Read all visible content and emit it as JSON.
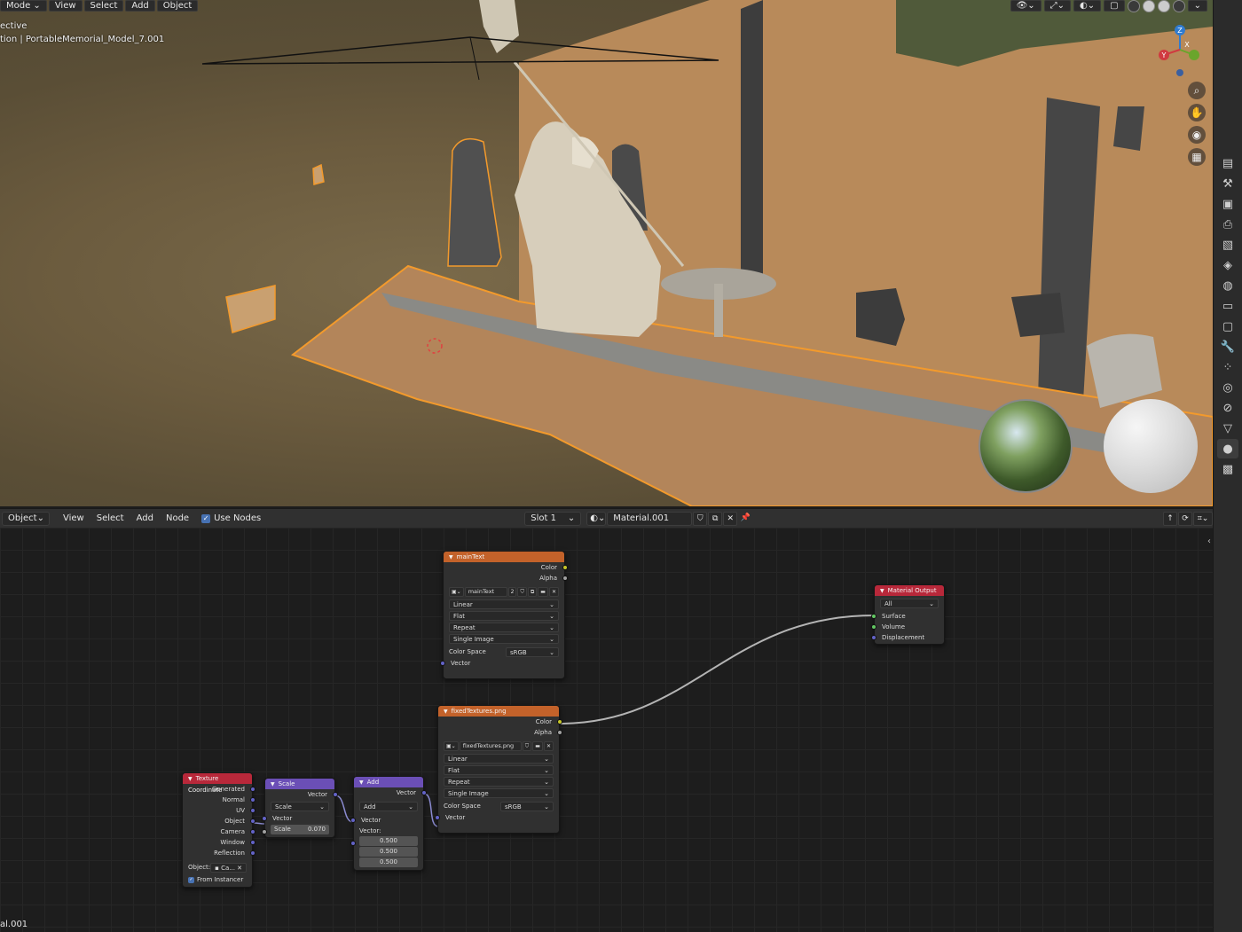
{
  "viewport": {
    "header": {
      "mode": "Mode",
      "menus": [
        "View",
        "Select",
        "Add",
        "Object"
      ]
    },
    "overlay_line1": "ective",
    "overlay_line2": "tion | PortableMemorial_Model_7.001",
    "gizmo_labels": {
      "z": "Z",
      "y": "Y",
      "x": "X"
    }
  },
  "node_editor": {
    "header": {
      "object_mode": "Object",
      "menus": [
        "View",
        "Select",
        "Add",
        "Node"
      ],
      "use_nodes_label": "Use Nodes",
      "slot": "Slot 1",
      "material": "Material.001"
    },
    "nodes": {
      "main_text": {
        "title": "mainText",
        "outputs": [
          "Color",
          "Alpha"
        ],
        "image_name": "mainText",
        "users": "2",
        "interpolation": "Linear",
        "projection": "Flat",
        "extension": "Repeat",
        "source": "Single Image",
        "color_space_label": "Color Space",
        "color_space": "sRGB",
        "input": "Vector"
      },
      "fixed_textures": {
        "title": "fixedTextures.png",
        "outputs": [
          "Color",
          "Alpha"
        ],
        "image_name": "fixedTextures.png",
        "interpolation": "Linear",
        "projection": "Flat",
        "extension": "Repeat",
        "source": "Single Image",
        "color_space_label": "Color Space",
        "color_space": "sRGB",
        "input": "Vector"
      },
      "material_output": {
        "title": "Material Output",
        "target": "All",
        "inputs": [
          "Surface",
          "Volume",
          "Displacement"
        ]
      },
      "texture_coordinate": {
        "title": "Texture Coordinate",
        "outputs": [
          "Generated",
          "Normal",
          "UV",
          "Object",
          "Camera",
          "Window",
          "Reflection"
        ],
        "object_label": "Object:",
        "object_value": "Ca...",
        "from_instancer": "From Instancer"
      },
      "scale": {
        "title": "Scale",
        "output": "Vector",
        "operation": "Scale",
        "input": "Vector",
        "scale_label": "Scale",
        "scale_value": "0.070"
      },
      "add": {
        "title": "Add",
        "output": "Vector",
        "operation": "Add",
        "input": "Vector",
        "vector_label": "Vector:",
        "values": [
          "0.500",
          "0.500",
          "0.500"
        ]
      }
    }
  },
  "status": {
    "material_label": "al.001"
  },
  "colors": {
    "image_header": "#c3622a",
    "output_header": "#b8283a",
    "vector_header": "#6b4fb6",
    "selection_outline": "#f39a2c"
  }
}
